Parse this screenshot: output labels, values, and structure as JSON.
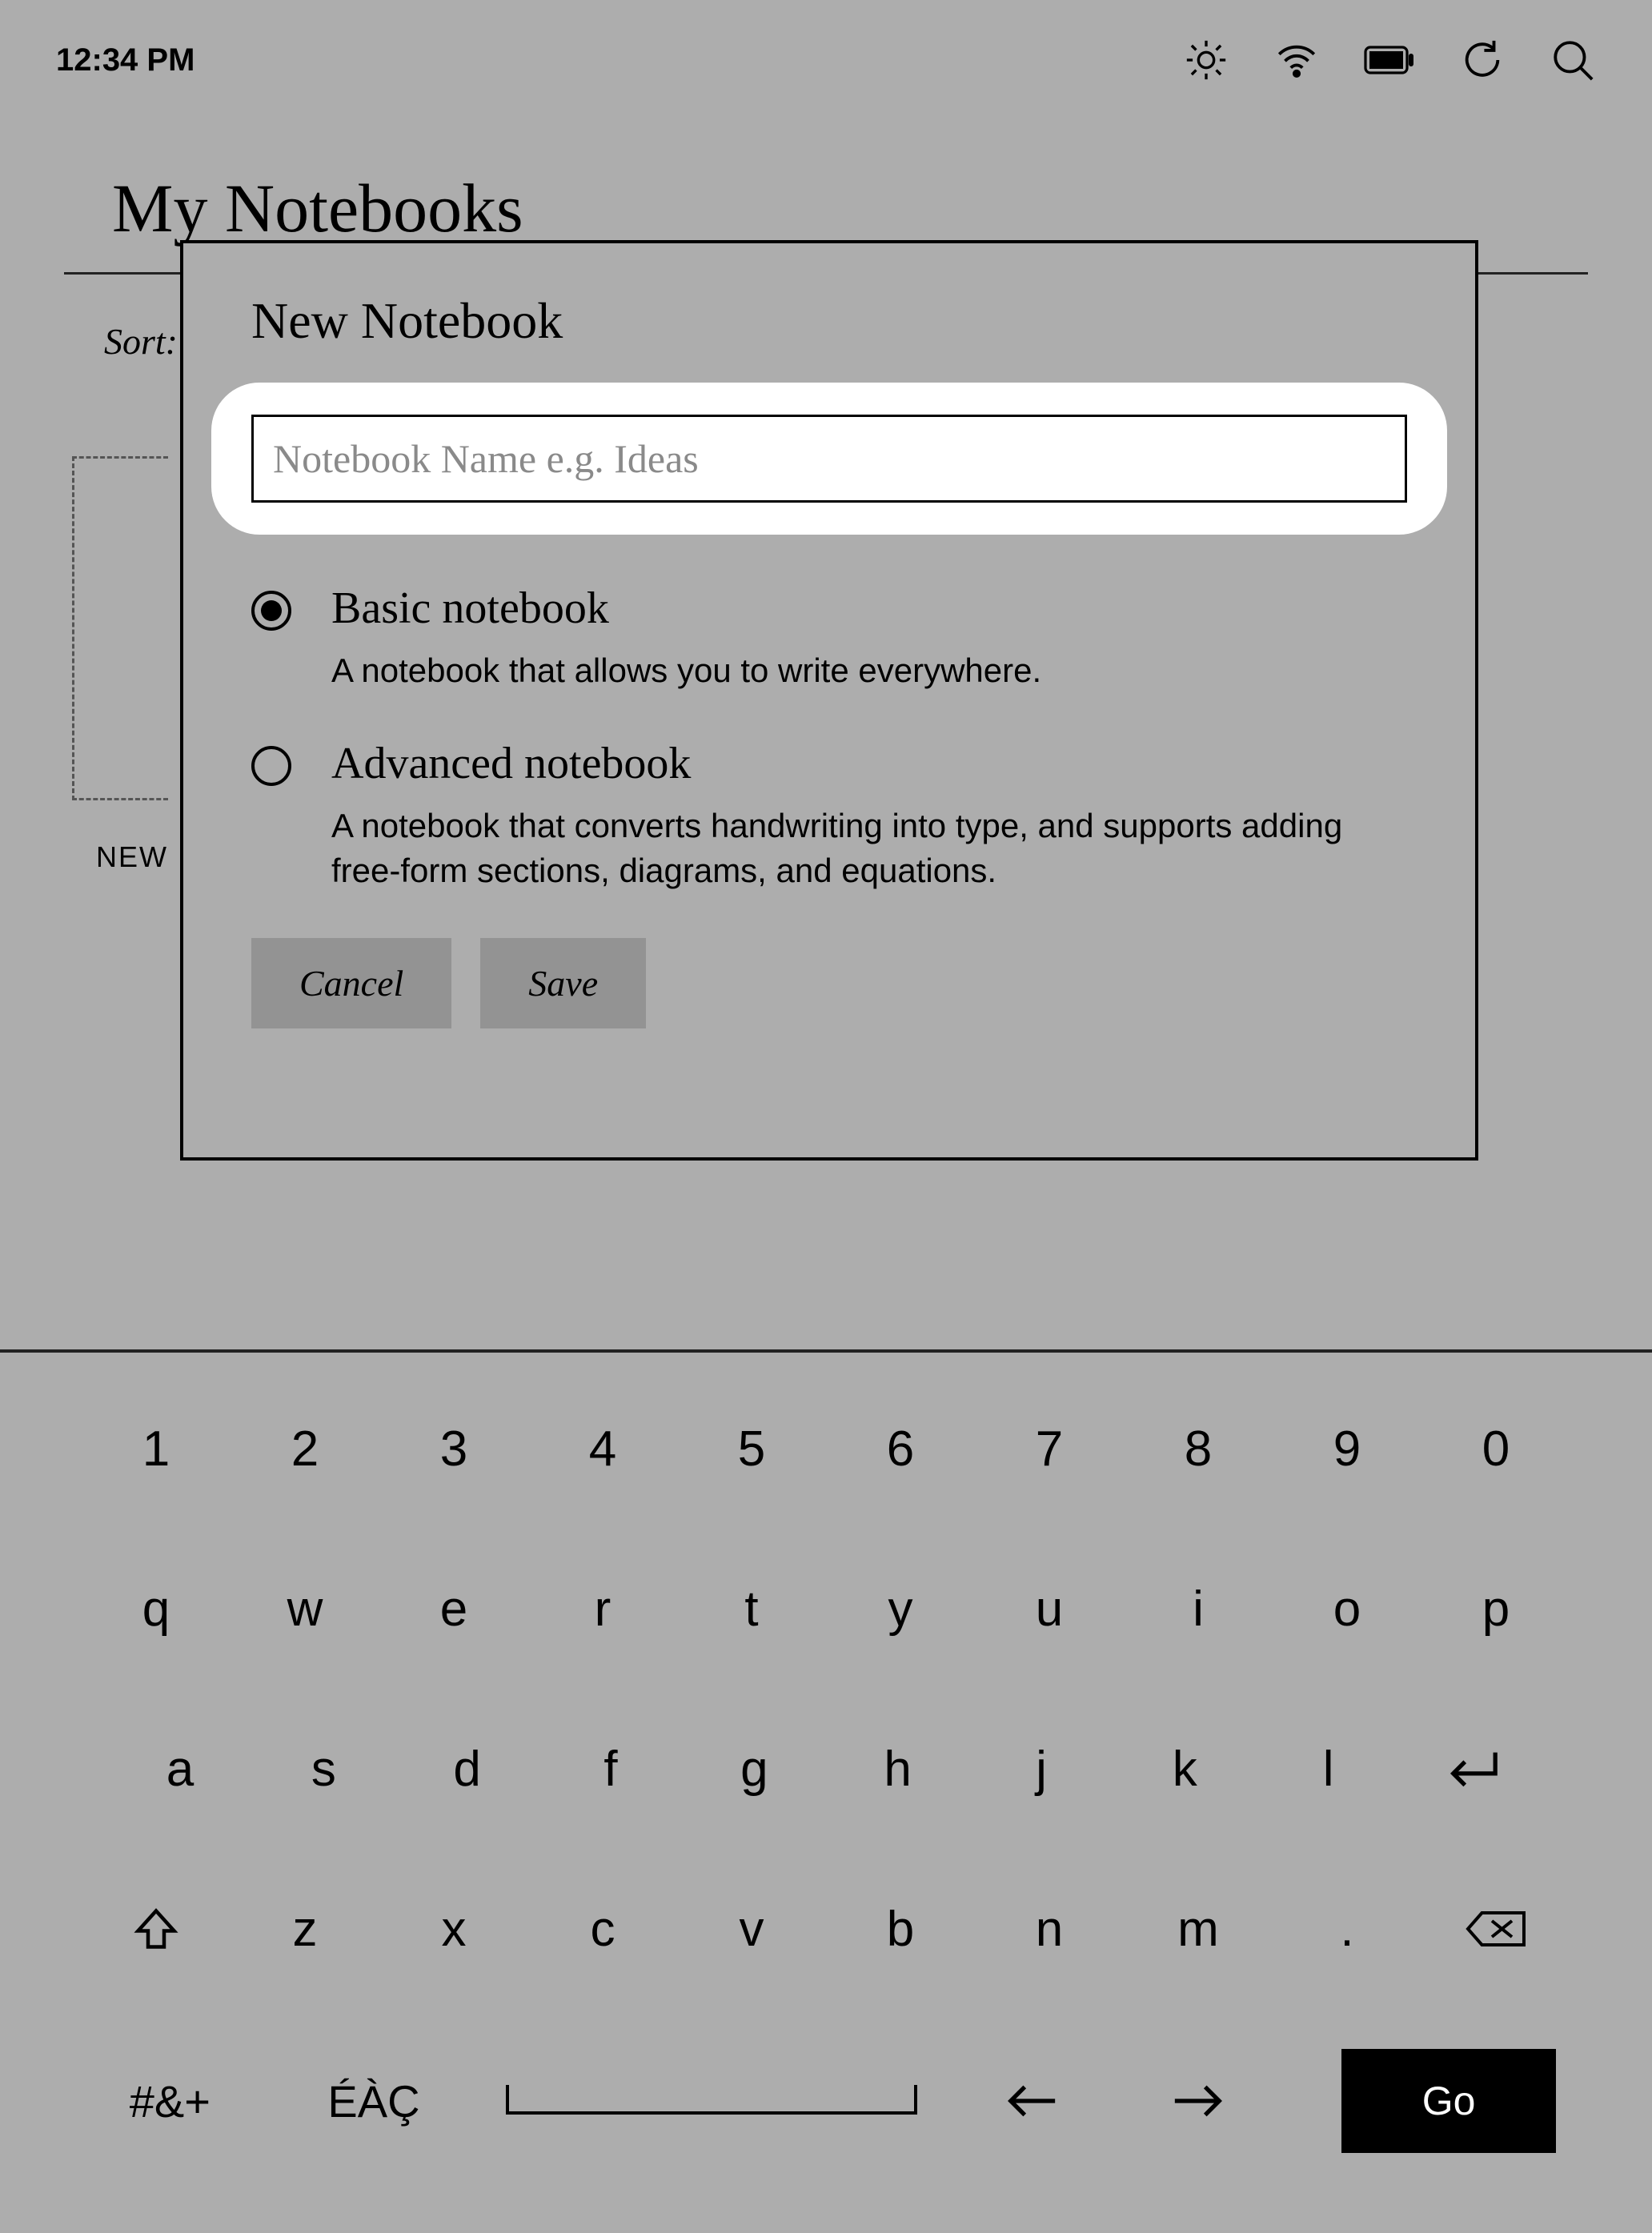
{
  "status": {
    "time": "12:34 PM"
  },
  "page": {
    "title": "My Notebooks",
    "sort_label": "Sort:"
  },
  "new_card_label": "NEW",
  "dialog": {
    "title": "New Notebook",
    "name_placeholder": "Notebook Name e.g. Ideas",
    "options": [
      {
        "title": "Basic notebook",
        "desc": "A notebook that allows you to write everywhere.",
        "selected": true
      },
      {
        "title": "Advanced notebook",
        "desc": "A notebook that converts handwriting into type, and supports adding free-form sections, diagrams, and equations.",
        "selected": false
      }
    ],
    "cancel": "Cancel",
    "save": "Save"
  },
  "keyboard": {
    "row1": [
      "1",
      "2",
      "3",
      "4",
      "5",
      "6",
      "7",
      "8",
      "9",
      "0"
    ],
    "row2": [
      "q",
      "w",
      "e",
      "r",
      "t",
      "y",
      "u",
      "i",
      "o",
      "p"
    ],
    "row3": [
      "a",
      "s",
      "d",
      "f",
      "g",
      "h",
      "j",
      "k",
      "l"
    ],
    "row4_letters": [
      "z",
      "x",
      "c",
      "v",
      "b",
      "n",
      "m",
      "."
    ],
    "symbols_key": "#&+",
    "accents_key": "ÉÀÇ",
    "go": "Go"
  }
}
